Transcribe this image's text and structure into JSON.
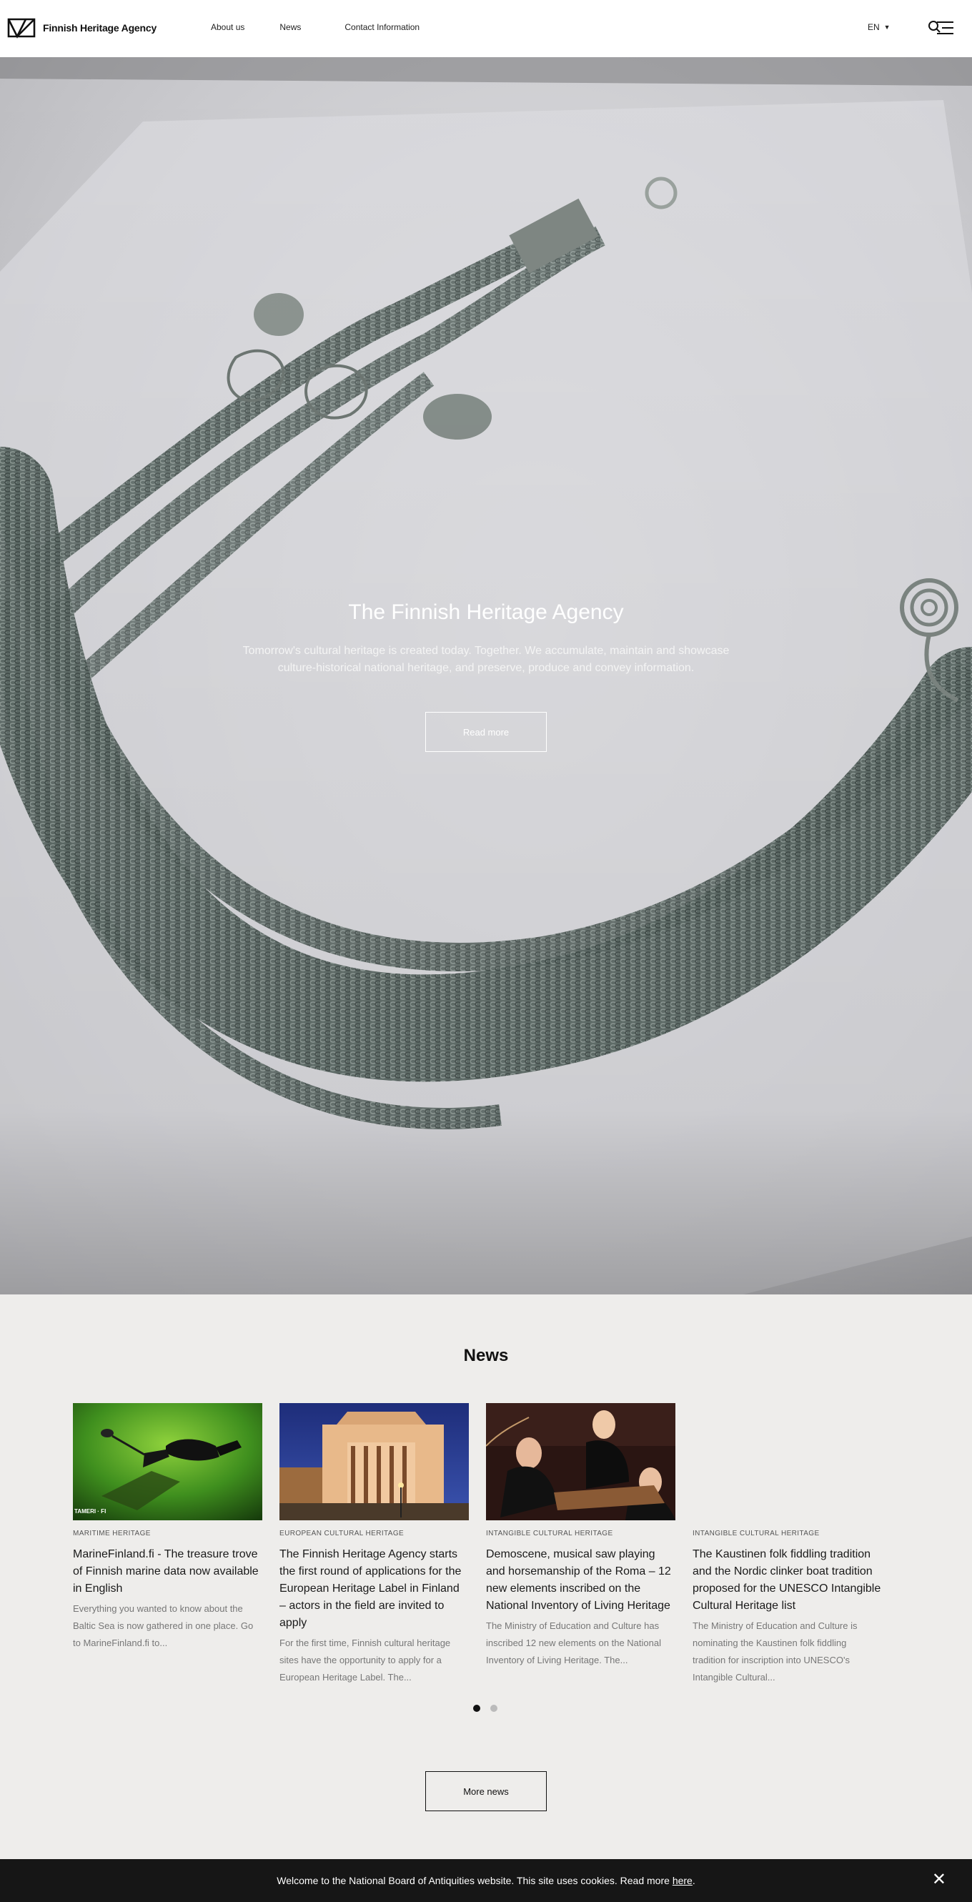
{
  "header": {
    "logo_text": "Finnish Heritage Agency",
    "nav": [
      "About us",
      "News",
      "Contact Information"
    ],
    "lang": "EN"
  },
  "hero": {
    "title": "The Finnish Heritage Agency",
    "text": "Tomorrow's cultural heritage is created today. Together. We accumulate, maintain and showcase culture-historical national heritage, and preserve, produce and convey information.",
    "button": "Read more"
  },
  "news": {
    "heading": "News",
    "items": [
      {
        "category": "MARITIME HERITAGE",
        "title": "MarineFinland.fi - The treasure trove of Finnish marine data now available in English",
        "desc": "Everything you wanted to know about the Baltic Sea is now gathered in one place. Go to MarineFinland.fi to...",
        "img_caption": "TAMERI · FI"
      },
      {
        "category": "EUROPEAN CULTURAL HERITAGE",
        "title": "The Finnish Heritage Agency starts the first round of applications for the European Heritage Label in Finland – actors in the field are invited to apply",
        "desc": "For the first time, Finnish cultural heritage sites have the opportunity to apply for a European Heritage Label. The..."
      },
      {
        "category": "INTANGIBLE CULTURAL HERITAGE",
        "title": "Demoscene, musical saw playing and horsemanship of the Roma – 12 new elements inscribed on the National Inventory of Living Heritage",
        "desc": "The Ministry of Education and Culture has inscribed 12 new elements on the National Inventory of Living Heritage. The..."
      },
      {
        "category": "INTANGIBLE CULTURAL HERITAGE",
        "title": "The Kaustinen folk fiddling tradition and the Nordic clinker boat tradition proposed for the UNESCO Intangible Cultural Heritage list",
        "desc": "The Ministry of Education and Culture is nominating the Kaustinen folk fiddling tradition for inscription into UNESCO's Intangible Cultural..."
      }
    ],
    "more_button": "More news"
  },
  "cookie": {
    "text": "Welcome to the National Board of Antiquities website. This site uses cookies. Read more",
    "link": "here",
    "suffix": "."
  }
}
